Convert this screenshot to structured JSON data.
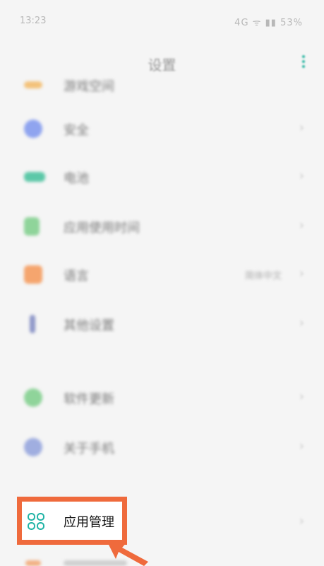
{
  "status_bar": {
    "time": "13:23",
    "icons_text": "4G ᯤ ▮▮ 53%"
  },
  "header": {
    "title": "设置"
  },
  "rows": [
    {
      "label": "游戏空间",
      "value": "",
      "icon_color": "#f3c27a"
    },
    {
      "label": "安全",
      "value": "",
      "icon_color": "#8fa4ef"
    },
    {
      "label": "电池",
      "value": "",
      "icon_color": "#5cc8a8"
    },
    {
      "label": "应用使用时间",
      "value": "",
      "icon_color": "#8fd49a"
    },
    {
      "label": "语言",
      "value": "简体中文",
      "icon_color": "#f5a56e"
    },
    {
      "label": "其他设置",
      "value": "",
      "icon_color": "#8f98c9"
    },
    {
      "label": "软件更新",
      "value": "",
      "icon_color": "#8fd49a"
    },
    {
      "label": "关于手机",
      "value": "",
      "icon_color": "#a0aee0"
    }
  ],
  "app_management": {
    "label": "应用管理",
    "icon": "grid-icon",
    "icon_color": "#1fb3a5"
  },
  "annotation": {
    "color": "#ef6a3c",
    "icon": "arrow-icon"
  }
}
